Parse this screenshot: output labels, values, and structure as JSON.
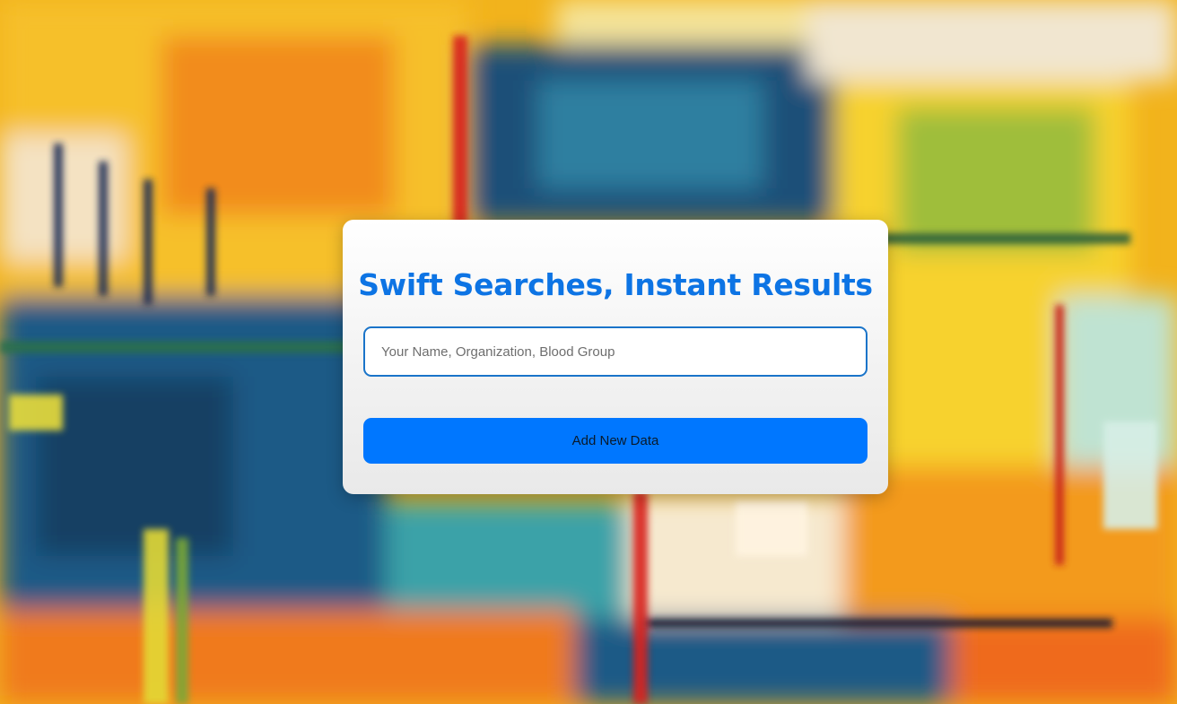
{
  "background": {
    "kind": "abstract-oil-painting",
    "colors": [
      "#f6c21a",
      "#f08a1c",
      "#1f5b86",
      "#2f8aa3",
      "#d92a22",
      "#f4e7c5",
      "#7fa93a"
    ]
  },
  "hero": {
    "title": "Swift Searches, Instant Results",
    "title_color": "#0d74e4"
  },
  "search": {
    "placeholder": "Your Name, Organization, Blood Group",
    "value": ""
  },
  "actions": {
    "add_label": "Add New Data",
    "add_color": "#0077ff"
  }
}
